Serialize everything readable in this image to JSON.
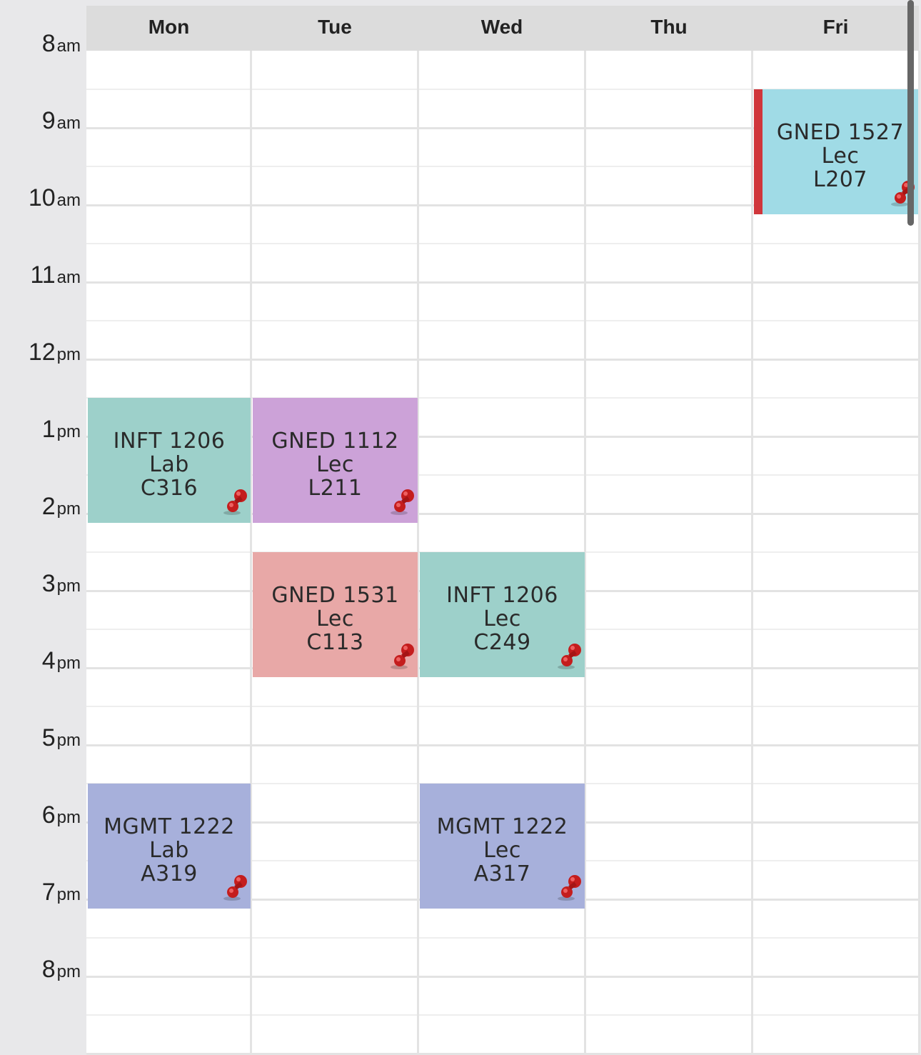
{
  "days": [
    "Mon",
    "Tue",
    "Wed",
    "Thu",
    "Fri"
  ],
  "times": [
    {
      "num": "8",
      "suffix": "am"
    },
    {
      "num": "9",
      "suffix": "am"
    },
    {
      "num": "10",
      "suffix": "am"
    },
    {
      "num": "11",
      "suffix": "am"
    },
    {
      "num": "12",
      "suffix": "pm"
    },
    {
      "num": "1",
      "suffix": "pm"
    },
    {
      "num": "2",
      "suffix": "pm"
    },
    {
      "num": "3",
      "suffix": "pm"
    },
    {
      "num": "4",
      "suffix": "pm"
    },
    {
      "num": "5",
      "suffix": "pm"
    },
    {
      "num": "6",
      "suffix": "pm"
    },
    {
      "num": "7",
      "suffix": "pm"
    },
    {
      "num": "8",
      "suffix": "pm"
    }
  ],
  "events": [
    {
      "day": "Fri",
      "start": "8:30",
      "end": "10:15",
      "course": "GNED 1527",
      "type": "Lec",
      "room": "L207",
      "color": "#a0dbe6",
      "accent": "#d0363b"
    },
    {
      "day": "Mon",
      "start": "12:30",
      "end": "2:15",
      "course": "INFT 1206",
      "type": "Lab",
      "room": "C316",
      "color": "#9dd0ca"
    },
    {
      "day": "Tue",
      "start": "12:30",
      "end": "2:15",
      "course": "GNED 1112",
      "type": "Lec",
      "room": "L211",
      "color": "#cca2d8"
    },
    {
      "day": "Tue",
      "start": "2:30",
      "end": "4:15",
      "course": "GNED 1531",
      "type": "Lec",
      "room": "C113",
      "color": "#e8a8a7"
    },
    {
      "day": "Wed",
      "start": "2:30",
      "end": "4:15",
      "course": "INFT 1206",
      "type": "Lec",
      "room": "C249",
      "color": "#9dd0ca"
    },
    {
      "day": "Mon",
      "start": "5:30",
      "end": "7:15",
      "course": "MGMT 1222",
      "type": "Lab",
      "room": "A319",
      "color": "#a7b0db"
    },
    {
      "day": "Wed",
      "start": "5:30",
      "end": "7:15",
      "course": "MGMT 1222",
      "type": "Lec",
      "room": "A317",
      "color": "#a7b0db"
    }
  ],
  "icons": {
    "pin": "pushpin-icon"
  }
}
